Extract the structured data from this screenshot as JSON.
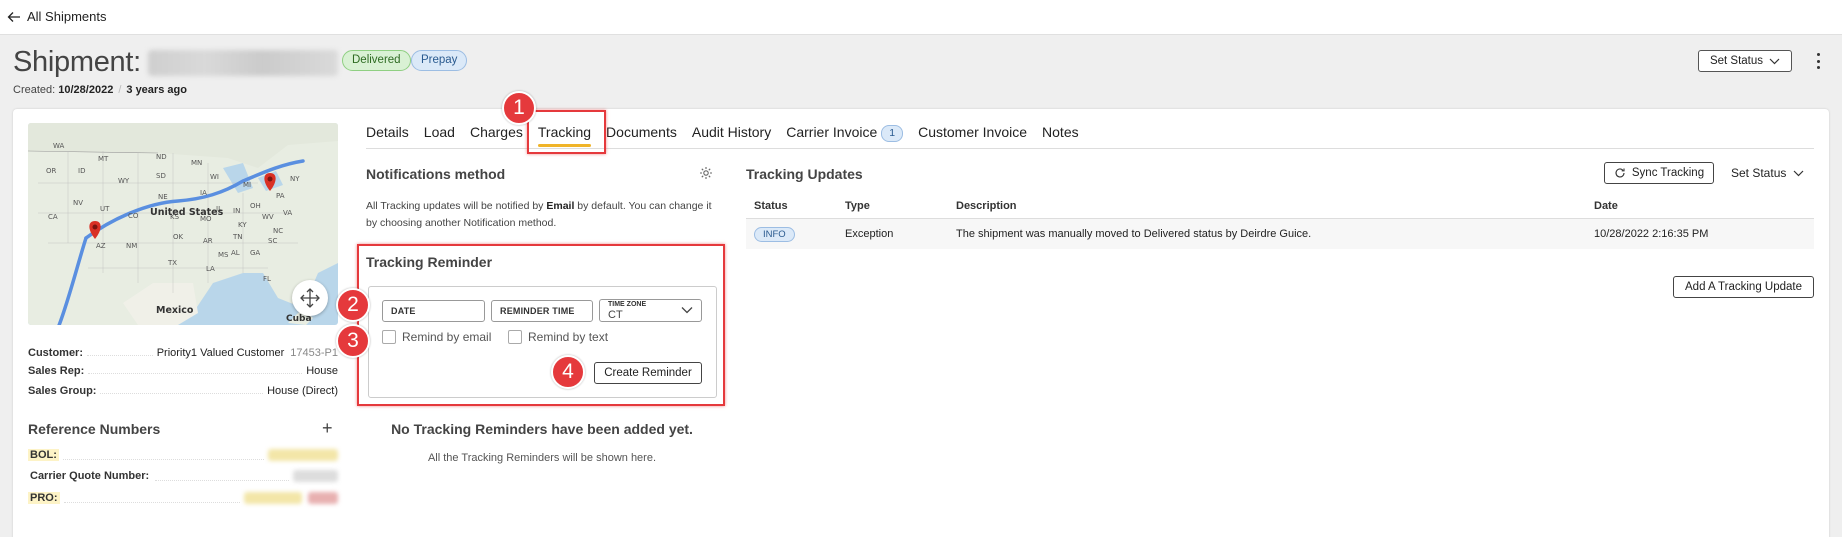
{
  "nav": {
    "back_label": "All Shipments"
  },
  "header": {
    "title": "Shipment:",
    "badges": {
      "delivered": "Delivered",
      "prepay": "Prepay"
    },
    "created_label": "Created:",
    "created_date": "10/28/2022",
    "created_relative": "3 years ago",
    "set_status_label": "Set Status"
  },
  "map": {
    "labels": {
      "us": "United States",
      "mexico": "Mexico",
      "cuba": "Cuba"
    },
    "states": [
      "MT",
      "ND",
      "MN",
      "WI",
      "MI",
      "SD",
      "WY",
      "NE",
      "IA",
      "IL",
      "IN",
      "OH",
      "PA",
      "NY",
      "NV",
      "UT",
      "CO",
      "KS",
      "MO",
      "KY",
      "WV",
      "VA",
      "NC",
      "TN",
      "AR",
      "OK",
      "AZ",
      "NM",
      "TX",
      "MS",
      "AL",
      "GA",
      "LA",
      "FL",
      "CA",
      "OR",
      "WA",
      "ID",
      "SC"
    ]
  },
  "details": {
    "customer_label": "Customer:",
    "customer_value": "Priority1 Valued Customer",
    "customer_extra": "17453-P1",
    "sales_rep_label": "Sales Rep:",
    "sales_rep_value": "House",
    "sales_group_label": "Sales Group:",
    "sales_group_value": "House (Direct)"
  },
  "references": {
    "title": "Reference Numbers",
    "add": "+",
    "bol_label": "BOL:",
    "carrier_quote_label": "Carrier Quote Number:",
    "pro_label": "PRO:"
  },
  "tabs": [
    {
      "label": "Details"
    },
    {
      "label": "Load"
    },
    {
      "label": "Charges"
    },
    {
      "label": "Tracking",
      "active": true
    },
    {
      "label": "Documents"
    },
    {
      "label": "Audit History"
    },
    {
      "label": "Carrier Invoice",
      "count": "1"
    },
    {
      "label": "Customer Invoice"
    },
    {
      "label": "Notes"
    }
  ],
  "notifications": {
    "title": "Notifications method",
    "desc_before": "All Tracking updates will be notified by ",
    "desc_bold": "Email",
    "desc_after": " by default. You can change it by choosing another Notification method."
  },
  "reminder": {
    "title": "Tracking Reminder",
    "date_label": "DATE",
    "time_label": "REMINDER TIME",
    "tz_label": "TIME ZONE",
    "tz_value": "CT",
    "email_label": "Remind by email",
    "text_label": "Remind by text",
    "create_label": "Create Reminder",
    "empty_title": "No Tracking Reminders have been added yet.",
    "empty_desc": "All the Tracking Reminders will be shown here."
  },
  "annotations": {
    "step1": "1",
    "step2": "2",
    "step3": "3",
    "step4": "4"
  },
  "tracking_updates": {
    "title": "Tracking Updates",
    "sync_label": "Sync Tracking",
    "set_status_label": "Set Status",
    "columns": [
      "Status",
      "Type",
      "Description",
      "Date"
    ],
    "rows": [
      {
        "status": "INFO",
        "type": "Exception",
        "description": "The shipment was manually moved to Delivered status by Deirdre Guice.",
        "date": "10/28/2022 2:16:35 PM"
      }
    ],
    "add_label": "Add A Tracking Update"
  },
  "colors": {
    "accent": "#f0b429",
    "annotation_red": "#e5393c",
    "delivered_green": "#d9f1d4",
    "info_blue": "#dbe9f8"
  }
}
